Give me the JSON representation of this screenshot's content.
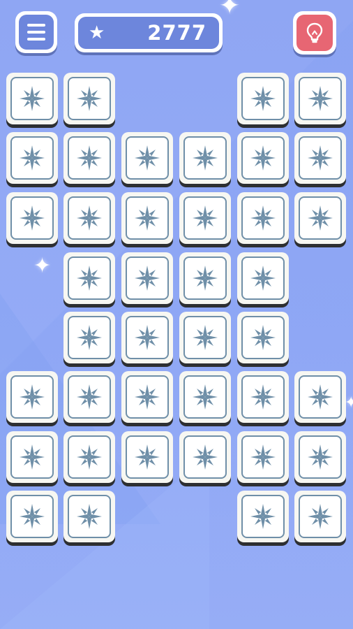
{
  "top_bar": {
    "score": "2777",
    "menu_icon": "hamburger-menu-icon",
    "hint_icon": "lightbulb-icon",
    "star_icon": "star-icon",
    "colors": {
      "menu_fill": "#6d86dc",
      "score_fill": "#6d86dc",
      "hint_fill": "#e76673",
      "white": "#ffffff"
    }
  },
  "board": {
    "tile_icon": "snowflake-icon",
    "tile_colors": {
      "tile": "#f7f7f2",
      "border": "#6f8fa8",
      "icon": "#6f8fa8"
    },
    "rows": [
      [
        true,
        true,
        false,
        false,
        true,
        true
      ],
      [
        true,
        true,
        true,
        true,
        true,
        true
      ],
      [
        true,
        true,
        true,
        true,
        true,
        true
      ],
      [
        false,
        true,
        true,
        true,
        true,
        false
      ],
      [
        false,
        true,
        true,
        true,
        true,
        false
      ],
      [
        true,
        true,
        true,
        true,
        true,
        true
      ],
      [
        true,
        true,
        true,
        true,
        true,
        true
      ],
      [
        true,
        true,
        false,
        false,
        true,
        true
      ]
    ]
  },
  "background": {
    "color": "#93a9f4"
  }
}
